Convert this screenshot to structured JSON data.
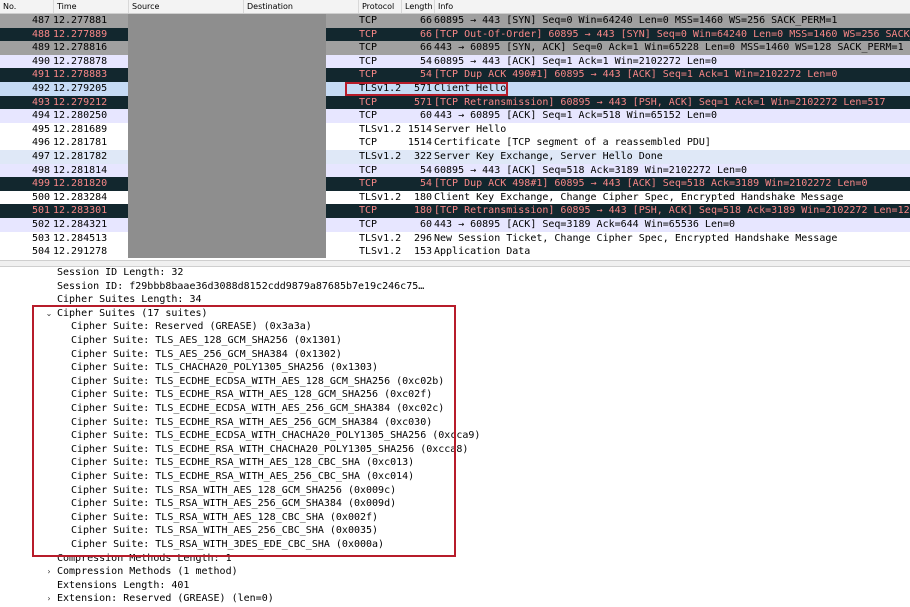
{
  "columns": {
    "no": "No.",
    "time": "Time",
    "source": "Source",
    "destination": "Destination",
    "protocol": "Protocol",
    "length": "Length",
    "info": "Info"
  },
  "packets": [
    {
      "no": "487",
      "time": "12.277881",
      "protocol": "TCP",
      "length": "66",
      "info": "60895 → 443 [SYN] Seq=0 Win=64240 Len=0 MSS=1460 WS=256 SACK_PERM=1",
      "style": "gray"
    },
    {
      "no": "488",
      "time": "12.277889",
      "protocol": "TCP",
      "length": "66",
      "info": "[TCP Out-Of-Order] 60895 → 443 [SYN] Seq=0 Win=64240 Len=0 MSS=1460 WS=256 SACK_PERM=1",
      "style": "bad"
    },
    {
      "no": "489",
      "time": "12.278816",
      "protocol": "TCP",
      "length": "66",
      "info": "443 → 60895 [SYN, ACK] Seq=0 Ack=1 Win=65228 Len=0 MSS=1460 WS=128 SACK_PERM=1",
      "style": "gray"
    },
    {
      "no": "490",
      "time": "12.278878",
      "protocol": "TCP",
      "length": "54",
      "info": "60895 → 443 [ACK] Seq=1 Ack=1 Win=2102272 Len=0",
      "style": "tcp"
    },
    {
      "no": "491",
      "time": "12.278883",
      "protocol": "TCP",
      "length": "54",
      "info": "[TCP Dup ACK 490#1] 60895 → 443 [ACK] Seq=1 Ack=1 Win=2102272 Len=0",
      "style": "bad"
    },
    {
      "no": "492",
      "time": "12.279205",
      "protocol": "TLSv1.2",
      "length": "571",
      "info": "Client Hello",
      "style": "sel"
    },
    {
      "no": "493",
      "time": "12.279212",
      "protocol": "TCP",
      "length": "571",
      "info": "[TCP Retransmission] 60895 → 443 [PSH, ACK] Seq=1 Ack=1 Win=2102272 Len=517",
      "style": "bad"
    },
    {
      "no": "494",
      "time": "12.280250",
      "protocol": "TCP",
      "length": "60",
      "info": "443 → 60895 [ACK] Seq=1 Ack=518 Win=65152 Len=0",
      "style": "tcp"
    },
    {
      "no": "495",
      "time": "12.281689",
      "protocol": "TLSv1.2",
      "length": "1514",
      "info": "Server Hello",
      "style": "tls"
    },
    {
      "no": "496",
      "time": "12.281781",
      "protocol": "TCP",
      "length": "1514",
      "info": "Certificate [TCP segment of a reassembled PDU]",
      "style": "tls"
    },
    {
      "no": "497",
      "time": "12.281782",
      "protocol": "TLSv1.2",
      "length": "322",
      "info": "Server Key Exchange, Server Hello Done",
      "style": "tls2"
    },
    {
      "no": "498",
      "time": "12.281814",
      "protocol": "TCP",
      "length": "54",
      "info": "60895 → 443 [ACK] Seq=518 Ack=3189 Win=2102272 Len=0",
      "style": "tcp"
    },
    {
      "no": "499",
      "time": "12.281820",
      "protocol": "TCP",
      "length": "54",
      "info": "[TCP Dup ACK 498#1] 60895 → 443 [ACK] Seq=518 Ack=3189 Win=2102272 Len=0",
      "style": "bad"
    },
    {
      "no": "500",
      "time": "12.283284",
      "protocol": "TLSv1.2",
      "length": "180",
      "info": "Client Key Exchange, Change Cipher Spec, Encrypted Handshake Message",
      "style": "tls"
    },
    {
      "no": "501",
      "time": "12.283301",
      "protocol": "TCP",
      "length": "180",
      "info": "[TCP Retransmission] 60895 → 443 [PSH, ACK] Seq=518 Ack=3189 Win=2102272 Len=126",
      "style": "bad"
    },
    {
      "no": "502",
      "time": "12.284321",
      "protocol": "TCP",
      "length": "60",
      "info": "443 → 60895 [ACK] Seq=3189 Ack=644 Win=65536 Len=0",
      "style": "tcp"
    },
    {
      "no": "503",
      "time": "12.284513",
      "protocol": "TLSv1.2",
      "length": "296",
      "info": "New Session Ticket, Change Cipher Spec, Encrypted Handshake Message",
      "style": "tls"
    },
    {
      "no": "504",
      "time": "12.291278",
      "protocol": "TLSv1.2",
      "length": "153",
      "info": "Application Data",
      "style": "tls"
    }
  ],
  "details": [
    {
      "indent": 0,
      "toggle": "",
      "text": "Session ID Length: 32"
    },
    {
      "indent": 0,
      "toggle": "",
      "text": "Session ID: f29bbb8baae36d3088d8152cdd9879a87685b7e19c246c75…"
    },
    {
      "indent": 0,
      "toggle": "",
      "text": "Cipher Suites Length: 34"
    },
    {
      "indent": 0,
      "toggle": "open",
      "text": "Cipher Suites (17 suites)"
    },
    {
      "indent": 1,
      "toggle": "",
      "text": "Cipher Suite: Reserved (GREASE) (0x3a3a)"
    },
    {
      "indent": 1,
      "toggle": "",
      "text": "Cipher Suite: TLS_AES_128_GCM_SHA256 (0x1301)"
    },
    {
      "indent": 1,
      "toggle": "",
      "text": "Cipher Suite: TLS_AES_256_GCM_SHA384 (0x1302)"
    },
    {
      "indent": 1,
      "toggle": "",
      "text": "Cipher Suite: TLS_CHACHA20_POLY1305_SHA256 (0x1303)"
    },
    {
      "indent": 1,
      "toggle": "",
      "text": "Cipher Suite: TLS_ECDHE_ECDSA_WITH_AES_128_GCM_SHA256 (0xc02b)"
    },
    {
      "indent": 1,
      "toggle": "",
      "text": "Cipher Suite: TLS_ECDHE_RSA_WITH_AES_128_GCM_SHA256 (0xc02f)"
    },
    {
      "indent": 1,
      "toggle": "",
      "text": "Cipher Suite: TLS_ECDHE_ECDSA_WITH_AES_256_GCM_SHA384 (0xc02c)"
    },
    {
      "indent": 1,
      "toggle": "",
      "text": "Cipher Suite: TLS_ECDHE_RSA_WITH_AES_256_GCM_SHA384 (0xc030)"
    },
    {
      "indent": 1,
      "toggle": "",
      "text": "Cipher Suite: TLS_ECDHE_ECDSA_WITH_CHACHA20_POLY1305_SHA256 (0xcca9)"
    },
    {
      "indent": 1,
      "toggle": "",
      "text": "Cipher Suite: TLS_ECDHE_RSA_WITH_CHACHA20_POLY1305_SHA256 (0xcca8)"
    },
    {
      "indent": 1,
      "toggle": "",
      "text": "Cipher Suite: TLS_ECDHE_RSA_WITH_AES_128_CBC_SHA (0xc013)"
    },
    {
      "indent": 1,
      "toggle": "",
      "text": "Cipher Suite: TLS_ECDHE_RSA_WITH_AES_256_CBC_SHA (0xc014)"
    },
    {
      "indent": 1,
      "toggle": "",
      "text": "Cipher Suite: TLS_RSA_WITH_AES_128_GCM_SHA256 (0x009c)"
    },
    {
      "indent": 1,
      "toggle": "",
      "text": "Cipher Suite: TLS_RSA_WITH_AES_256_GCM_SHA384 (0x009d)"
    },
    {
      "indent": 1,
      "toggle": "",
      "text": "Cipher Suite: TLS_RSA_WITH_AES_128_CBC_SHA (0x002f)"
    },
    {
      "indent": 1,
      "toggle": "",
      "text": "Cipher Suite: TLS_RSA_WITH_AES_256_CBC_SHA (0x0035)"
    },
    {
      "indent": 1,
      "toggle": "",
      "text": "Cipher Suite: TLS_RSA_WITH_3DES_EDE_CBC_SHA (0x000a)"
    },
    {
      "indent": 0,
      "toggle": "",
      "text": "Compression Methods Length: 1"
    },
    {
      "indent": 0,
      "toggle": "closed",
      "text": "Compression Methods (1 method)"
    },
    {
      "indent": 0,
      "toggle": "",
      "text": "Extensions Length: 401"
    },
    {
      "indent": 0,
      "toggle": "closed",
      "text": "Extension: Reserved (GREASE) (len=0)"
    }
  ],
  "icons": {
    "tree_open": "⌄",
    "tree_closed": "›"
  },
  "colors": {
    "highlight_box": "#b71c2a",
    "bad_row_bg": "#12272e",
    "bad_row_fg": "#f78787",
    "tcp_row_bg": "#e7e6ff",
    "handshake_row_bg": "#a0a0a0",
    "selected_row_bg": "#c6dbf5"
  }
}
